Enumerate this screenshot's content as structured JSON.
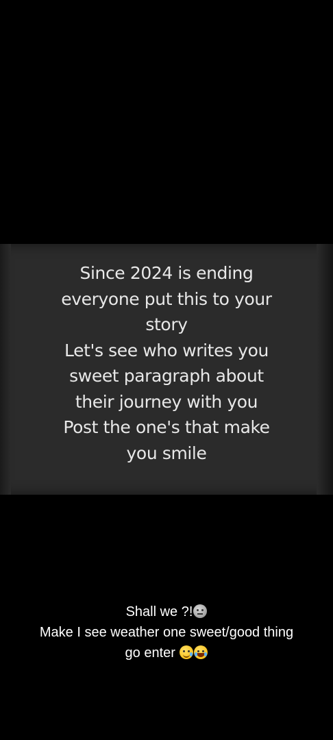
{
  "story_card": {
    "lines": [
      "Since 2024 is ending",
      "everyone put this to your",
      "story",
      "Let's see who writes you",
      "sweet paragraph about",
      "their journey with you",
      "Post the one's that make",
      "you smile"
    ]
  },
  "caption": {
    "line1": "Shall we ?!",
    "line1_emoji": "grimacing-neutral-face-icon",
    "line2": "Make I see weather one sweet/good thing",
    "line3": "go enter",
    "line3_emojis": [
      "smiling-face-with-tear-icon",
      "face-with-tears-of-joy-icon"
    ]
  }
}
